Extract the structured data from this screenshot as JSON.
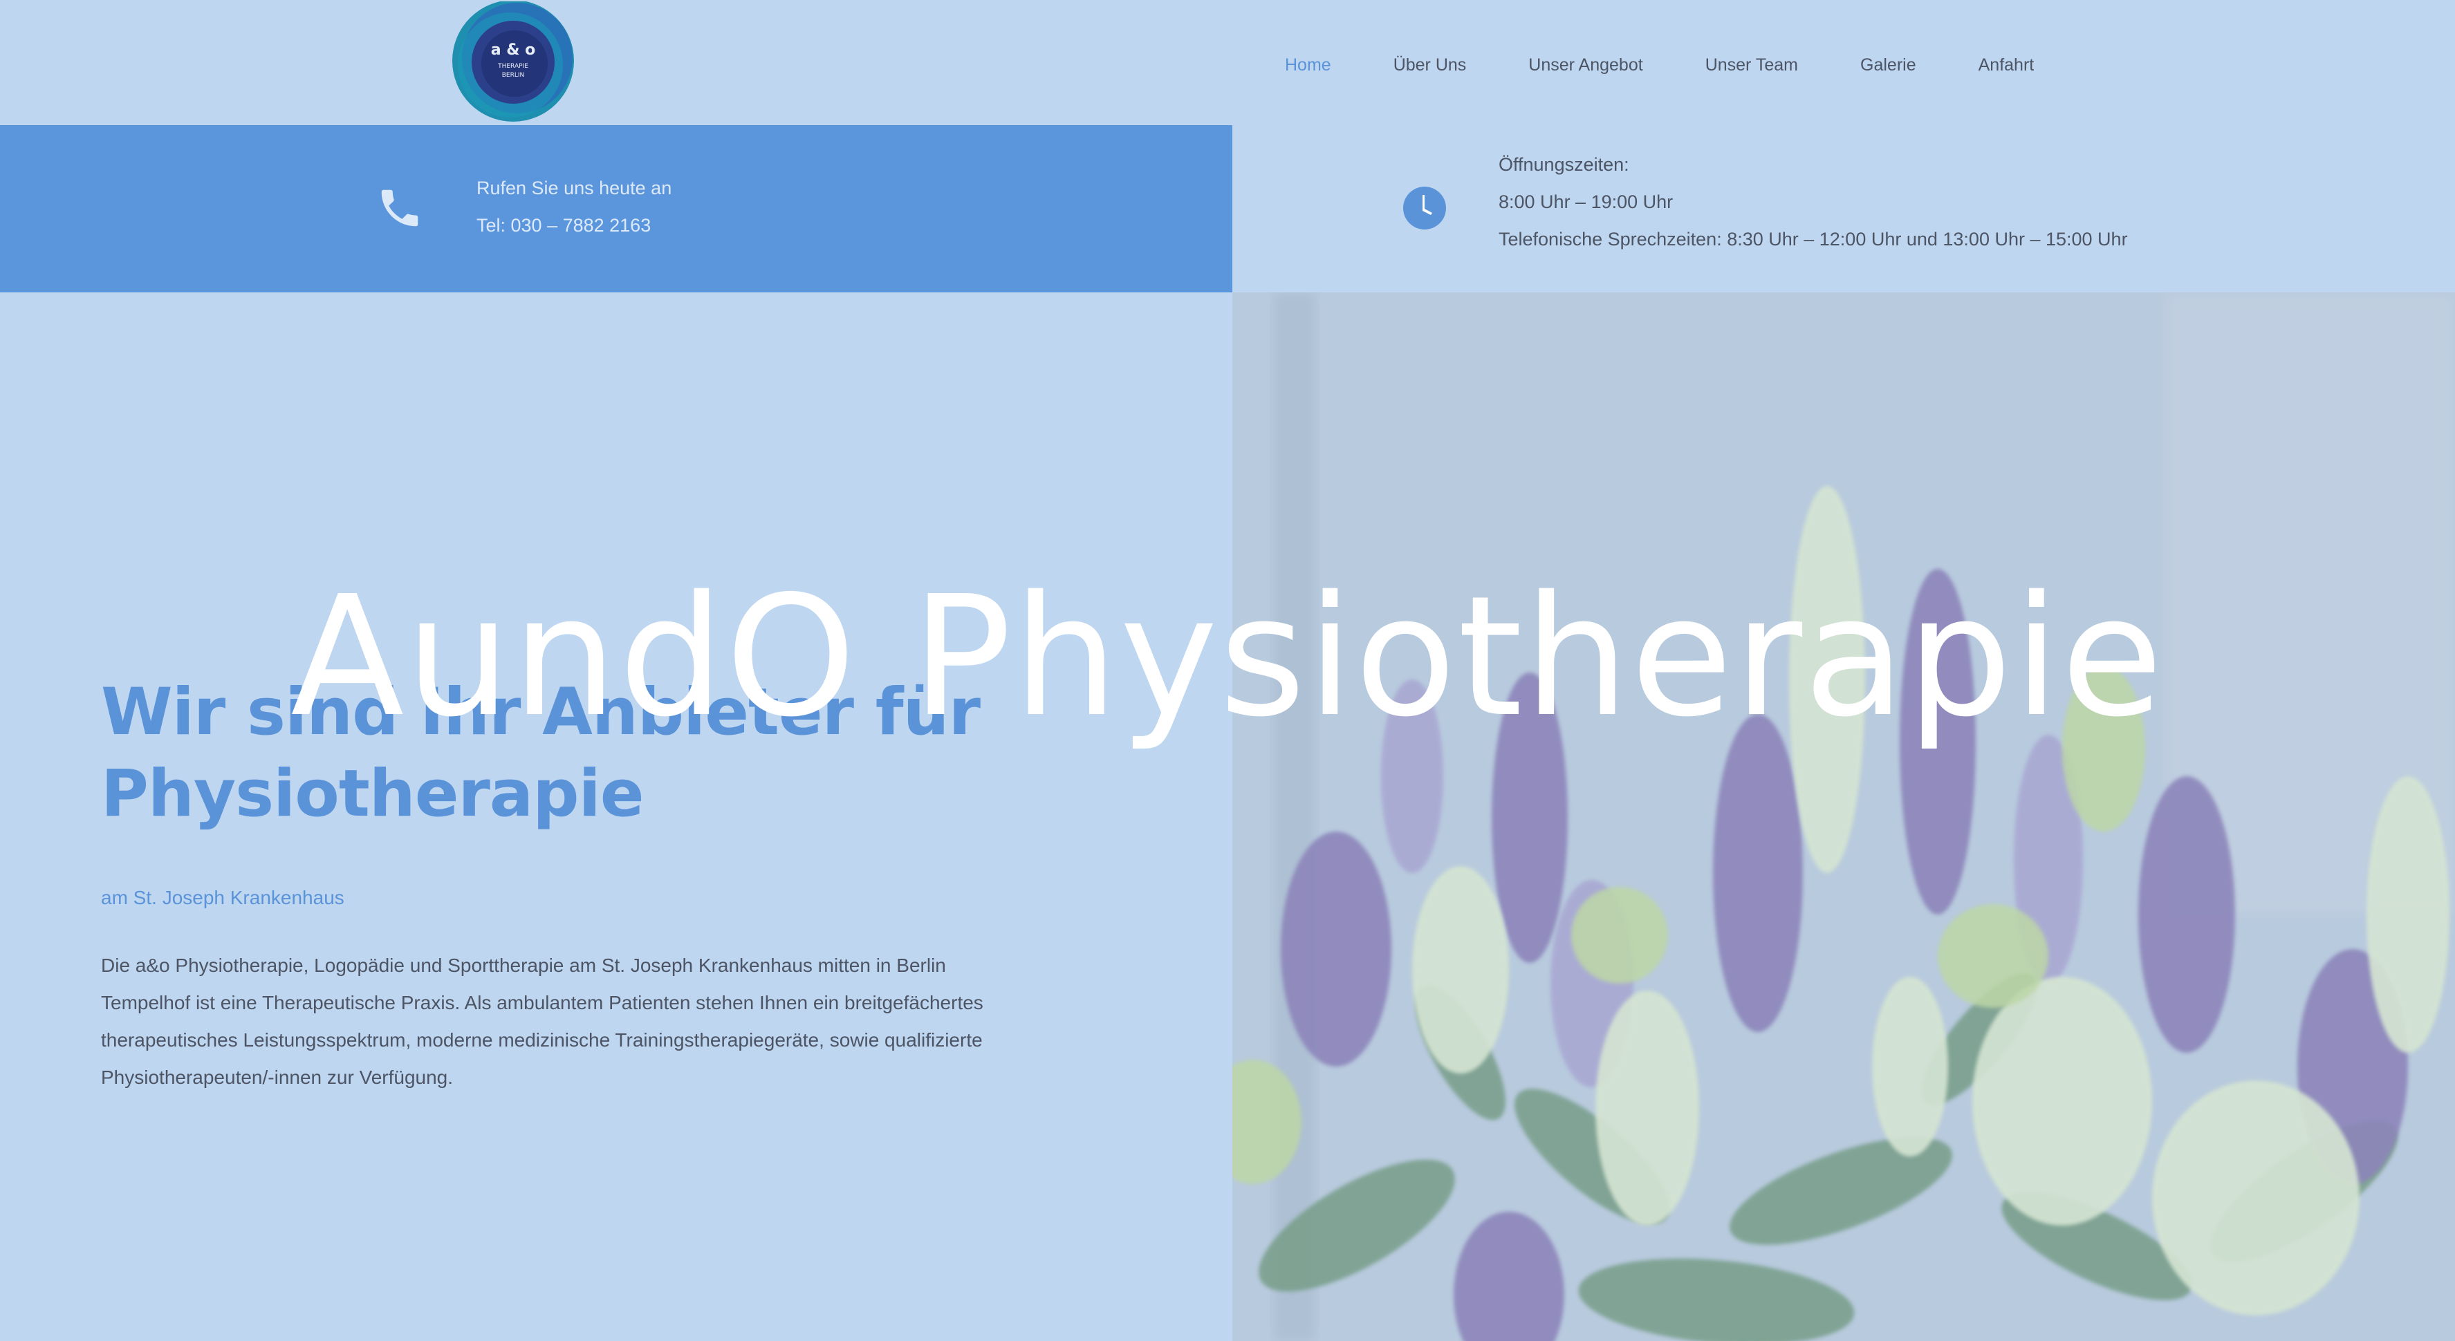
{
  "brand": {
    "logo_line1": "a & o",
    "logo_line2": "THERAPIE",
    "logo_line3": "BERLIN"
  },
  "nav": {
    "items": [
      {
        "label": "Home",
        "active": true
      },
      {
        "label": "Über Uns",
        "active": false
      },
      {
        "label": "Unser Angebot",
        "active": false
      },
      {
        "label": "Unser Team",
        "active": false
      },
      {
        "label": "Galerie",
        "active": false
      },
      {
        "label": "Anfahrt",
        "active": false
      }
    ]
  },
  "contact": {
    "line1": "Rufen Sie uns heute an",
    "line2": "Tel: 030 – 7882 2163",
    "icon": "phone-icon"
  },
  "hours": {
    "title": "Öffnungszeiten:",
    "line1": "8:00 Uhr – 19:00 Uhr",
    "line2": "Telefonische Sprechzeiten: 8:30 Uhr – 12:00 Uhr und 13:00 Uhr – 15:00 Uhr",
    "icon": "clock-icon"
  },
  "hero": {
    "overlay_title": "AundO Physiotherapie",
    "headline_line1": "Wir sind Ihr Anbieter für",
    "headline_line2": "Physiotherapie",
    "subtitle": "am St. Joseph Krankenhaus",
    "intro": "Die a&o Physiotherapie, Logopädie und Sporttherapie am St. Joseph Krankenhaus mitten in Berlin Tempelhof ist eine Therapeutische Praxis. Als ambulantem Patienten stehen Ihnen ein breitgefächertes therapeutisches Leistungsspektrum, moderne medizinische Trainingstherapiegeräte, sowie qualifizierte Physiotherapeuten/-innen zur Verfügung."
  },
  "colors": {
    "accent": "#5b93d9",
    "page_bg": "#bed6f0",
    "text": "#4d5565",
    "white": "#ffffff"
  }
}
